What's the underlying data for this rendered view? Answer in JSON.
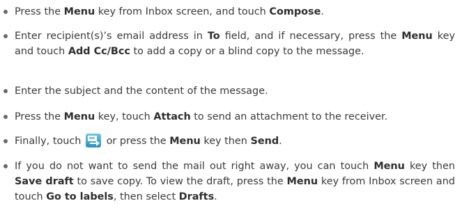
{
  "steps": [
    {
      "segments": [
        {
          "t": "Press the "
        },
        {
          "t": "Menu",
          "b": true
        },
        {
          "t": " key from Inbox screen, and touch "
        },
        {
          "t": "Compose",
          "b": true
        },
        {
          "t": "."
        }
      ]
    },
    {
      "segments": [
        {
          "t": "Enter recipient(s)’s email address in "
        },
        {
          "t": "To",
          "b": true
        },
        {
          "t": " field, and if necessary, press the "
        },
        {
          "t": "Menu",
          "b": true
        },
        {
          "t": " key and touch "
        },
        {
          "t": "Add Cc/Bcc",
          "b": true
        },
        {
          "t": " to add a copy or a blind copy to the message."
        }
      ]
    },
    {
      "segments": [
        {
          "t": "Enter the subject and the content of the message."
        }
      ]
    },
    {
      "segments": [
        {
          "t": "Press the "
        },
        {
          "t": "Menu",
          "b": true
        },
        {
          "t": " key, touch "
        },
        {
          "t": "Attach",
          "b": true
        },
        {
          "t": " to send an attachment to the receiver."
        }
      ]
    },
    {
      "segments": [
        {
          "t": "Finally, touch "
        },
        {
          "icon": "send-mail-icon"
        },
        {
          "t": " or press the "
        },
        {
          "t": "Menu",
          "b": true
        },
        {
          "t": " key then "
        },
        {
          "t": "Send",
          "b": true
        },
        {
          "t": "."
        }
      ]
    },
    {
      "segments": [
        {
          "t": "If you do not want to send the mail out right away, you can touch "
        },
        {
          "t": "Menu",
          "b": true
        },
        {
          "t": " key then "
        },
        {
          "t": "Save draft",
          "b": true
        },
        {
          "t": " to save copy. To view the draft, press the "
        },
        {
          "t": "Menu",
          "b": true
        },
        {
          "t": " key from Inbox screen and touch "
        },
        {
          "t": "Go to labels",
          "b": true
        },
        {
          "t": ", then select "
        },
        {
          "t": "Drafts",
          "b": true
        },
        {
          "t": "."
        }
      ]
    }
  ]
}
